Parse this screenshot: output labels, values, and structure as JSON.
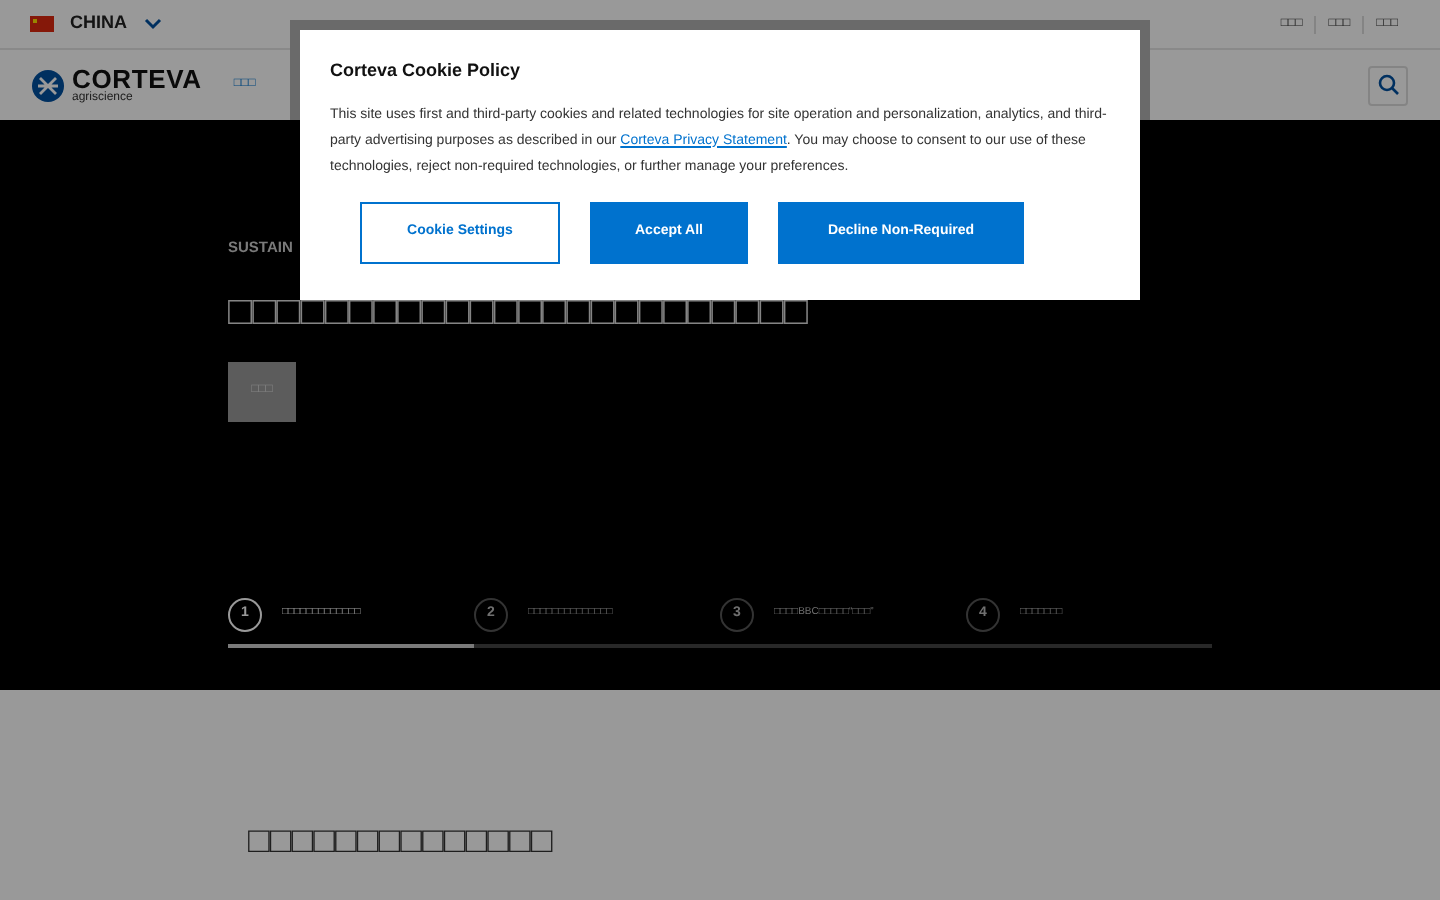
{
  "top_bar": {
    "region": "CHINA",
    "links": [
      "□□□",
      "□□□",
      "□□□"
    ]
  },
  "header": {
    "logo_name": "CORTEVA",
    "logo_tagline": "agriscience",
    "nav_items": [
      "□□□"
    ]
  },
  "hero": {
    "eyebrow": "SUSTAIN",
    "title": "□□□□□□□□□□□□□□□□□□□□□□□□",
    "button": "□□□",
    "steps": [
      {
        "number": "1",
        "label": "□□□□□□□□□□□□□",
        "selected": true
      },
      {
        "number": "2",
        "label": "□□□□□□□□□□□□□□",
        "selected": false
      },
      {
        "number": "3",
        "label": "□□□□BBC□□□□□“□□□”",
        "selected": false
      },
      {
        "number": "4",
        "label": "□□□□□□□",
        "selected": false
      }
    ]
  },
  "section": {
    "title": "□□□□□□□□□□□□□□"
  },
  "cookie_dialog": {
    "title": "Corteva Cookie Policy",
    "body_before_link": "This site uses first and third-party cookies and related technologies for site operation and personalization, analytics, and third-party advertising purposes as described in our",
    "link": "Corteva Privacy Statement",
    "body_after_link": ". You may choose to consent to our use of these technologies, reject non-required technologies, or further manage your preferences.",
    "buttons": [
      {
        "label": "Cookie Settings",
        "kind": "outline"
      },
      {
        "label": "Accept All",
        "kind": "filled"
      },
      {
        "label": "Decline Non-Required",
        "kind": "filled"
      }
    ]
  }
}
